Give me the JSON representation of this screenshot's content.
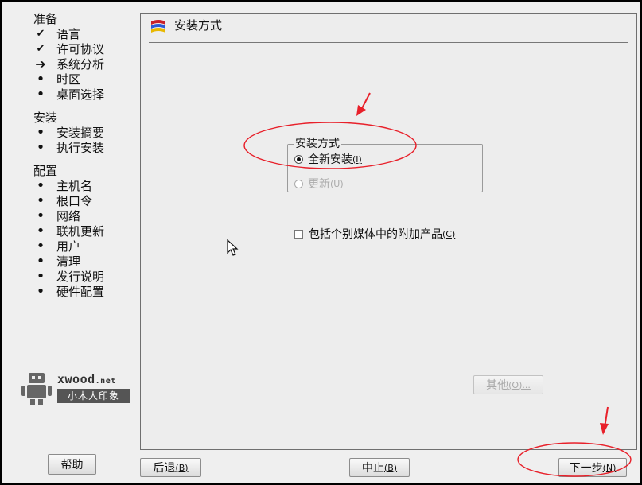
{
  "sidebar": {
    "sections": [
      {
        "title": "准备",
        "steps": [
          {
            "label": "语言",
            "state": "done"
          },
          {
            "label": "许可协议",
            "state": "done"
          },
          {
            "label": "系统分析",
            "state": "current"
          },
          {
            "label": "时区",
            "state": "todo"
          },
          {
            "label": "桌面选择",
            "state": "todo"
          }
        ]
      },
      {
        "title": "安装",
        "steps": [
          {
            "label": "安装摘要",
            "state": "todo"
          },
          {
            "label": "执行安装",
            "state": "todo"
          }
        ]
      },
      {
        "title": "配置",
        "steps": [
          {
            "label": "主机名",
            "state": "todo"
          },
          {
            "label": "根口令",
            "state": "todo"
          },
          {
            "label": "网络",
            "state": "todo"
          },
          {
            "label": "联机更新",
            "state": "todo"
          },
          {
            "label": "用户",
            "state": "todo"
          },
          {
            "label": "清理",
            "state": "todo"
          },
          {
            "label": "发行说明",
            "state": "todo"
          },
          {
            "label": "硬件配置",
            "state": "todo"
          }
        ]
      }
    ],
    "icons": {
      "done": "checkmark-icon",
      "current": "arrow-right-icon",
      "todo": "bullet-icon"
    },
    "logo": {
      "brand": "xwood",
      "brand_suffix": ".net",
      "subtitle": "小木人印象"
    }
  },
  "main": {
    "title": "安装方式",
    "group": {
      "legend": "安装方式",
      "options": [
        {
          "label": "全新安装",
          "mnemonic": "(I)",
          "checked": true,
          "enabled": true
        },
        {
          "label": "更新",
          "mnemonic": "(U)",
          "checked": false,
          "enabled": false
        }
      ]
    },
    "addon_checkbox": {
      "label": "包括个别媒体中的附加产品",
      "mnemonic": "(C)",
      "checked": false
    },
    "other_button": {
      "label": "其他",
      "mnemonic": "(O)...",
      "enabled": false
    }
  },
  "footer": {
    "help": {
      "label": "帮助"
    },
    "back": {
      "label": "后退",
      "mnemonic": "(B)"
    },
    "abort": {
      "label": "中止",
      "mnemonic": "(B)"
    },
    "next": {
      "label": "下一步",
      "mnemonic": "(N)"
    }
  },
  "colors": {
    "annotation": "#e8202a",
    "background": "#efefef",
    "frame": "#000000"
  }
}
